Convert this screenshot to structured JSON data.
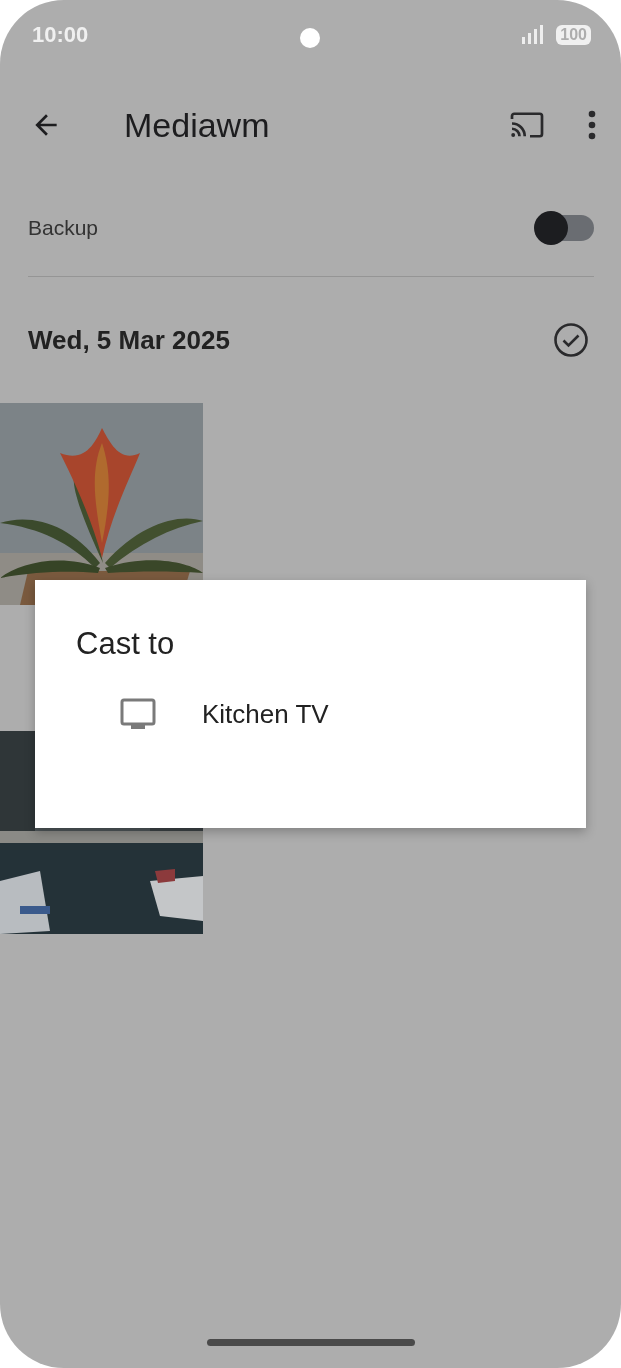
{
  "status_bar": {
    "time": "10:00",
    "battery": "100"
  },
  "app_bar": {
    "title": "Mediawm"
  },
  "backup": {
    "label": "Backup",
    "on": false
  },
  "date_group": {
    "date": "Wed, 5 Mar 2025"
  },
  "dialog": {
    "title": "Cast to",
    "devices": [
      {
        "name": "Kitchen TV"
      }
    ]
  }
}
